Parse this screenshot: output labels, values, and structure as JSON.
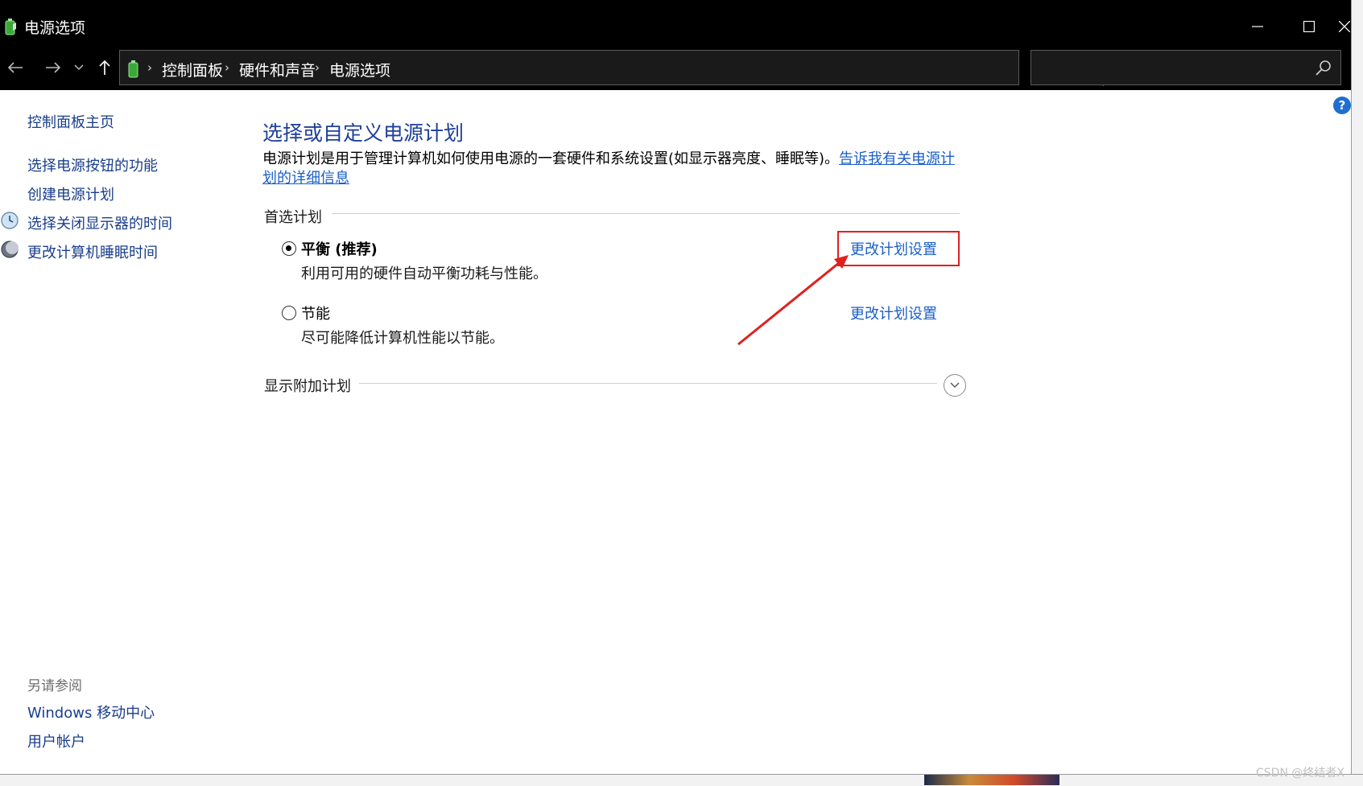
{
  "window": {
    "title": "电源选项",
    "minimize_icon": "minimize-icon",
    "maximize_icon": "maximize-icon",
    "close_icon": "close-icon"
  },
  "address": {
    "crumbs": [
      "控制面板",
      "硬件和声音",
      "电源选项"
    ],
    "search_placeholder": ""
  },
  "sidebar": {
    "home": "控制面板主页",
    "items": [
      {
        "label": "选择电源按钮的功能",
        "icon": null
      },
      {
        "label": "创建电源计划",
        "icon": null
      },
      {
        "label": "选择关闭显示器的时间",
        "icon": "monitor-clock-icon"
      },
      {
        "label": "更改计算机睡眠时间",
        "icon": "moon-icon"
      }
    ],
    "see_also_label": "另请参阅",
    "see_also": [
      "Windows 移动中心",
      "用户帐户"
    ]
  },
  "main": {
    "title": "选择或自定义电源计划",
    "description": "电源计划是用于管理计算机如何使用电源的一套硬件和系统设置(如显示器亮度、睡眠等)。",
    "description_link": "告诉我有关电源计划的详细信息",
    "preferred_label": "首选计划",
    "plans": [
      {
        "name": "平衡 (推荐)",
        "desc": "利用可用的硬件自动平衡功耗与性能。",
        "selected": true,
        "link": "更改计划设置"
      },
      {
        "name": "节能",
        "desc": "尽可能降低计算机性能以节能。",
        "selected": false,
        "link": "更改计划设置"
      }
    ],
    "additional_label": "显示附加计划"
  },
  "watermark": "CSDN @终结者X",
  "colors": {
    "link": "#1a5fc8",
    "title": "#1e3f9a",
    "highlight": "#e02020"
  }
}
